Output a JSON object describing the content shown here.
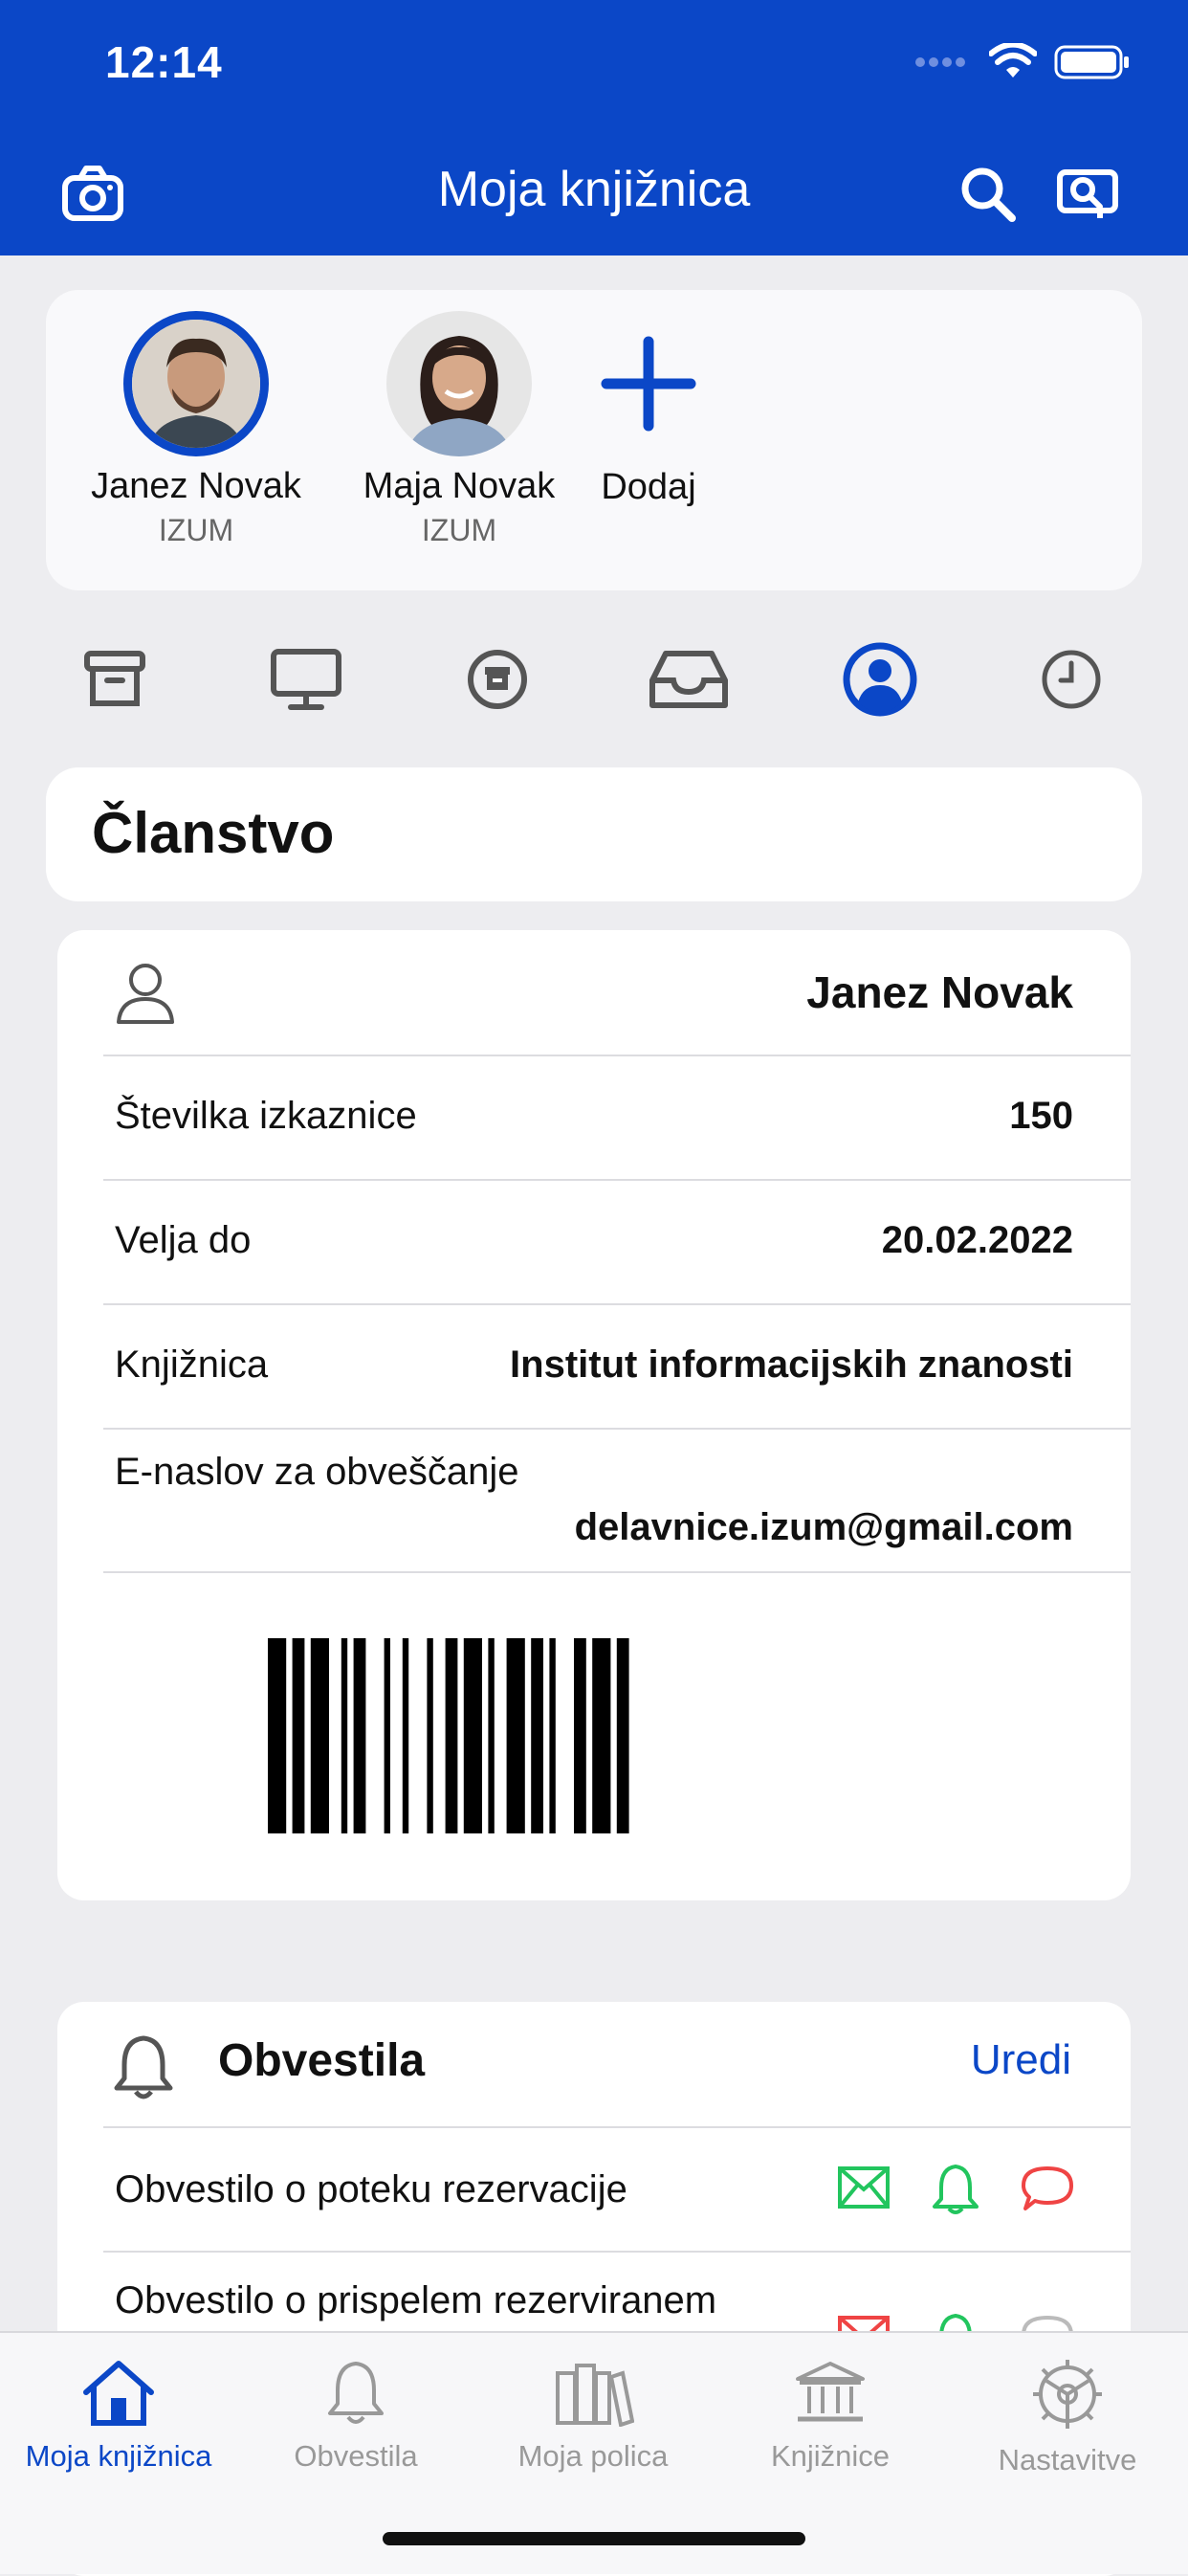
{
  "status": {
    "time": "12:14"
  },
  "header": {
    "title": "Moja knjižnica"
  },
  "profiles": [
    {
      "name": "Janez Novak",
      "org": "IZUM"
    },
    {
      "name": "Maja Novak",
      "org": "IZUM"
    }
  ],
  "add_label": "Dodaj",
  "section_title": "Članstvo",
  "membership": {
    "name": "Janez Novak",
    "card_label": "Številka izkaznice",
    "card_value": "150",
    "valid_label": "Velja do",
    "valid_value": "20.02.2022",
    "library_label": "Knjižnica",
    "library_value": "Institut informacijskih znanosti",
    "email_label": "E-naslov za obveščanje",
    "email_value": "delavnice.izum@gmail.com"
  },
  "notifications": {
    "title": "Obvestila",
    "edit": "Uredi",
    "items": [
      "Obvestilo o poteku rezervacije",
      "Obvestilo o prispelem rezerviranem"
    ]
  },
  "tabbar": [
    {
      "label": "Moja knjižnica",
      "icon": "home-icon"
    },
    {
      "label": "Obvestila",
      "icon": "bell-icon"
    },
    {
      "label": "Moja polica",
      "icon": "books-icon"
    },
    {
      "label": "Knjižnice",
      "icon": "library-building-icon"
    },
    {
      "label": "Nastavitve",
      "icon": "settings-icon"
    }
  ],
  "colors": {
    "brand": "#0b47c7",
    "green": "#22c55e",
    "red": "#ef4444"
  }
}
